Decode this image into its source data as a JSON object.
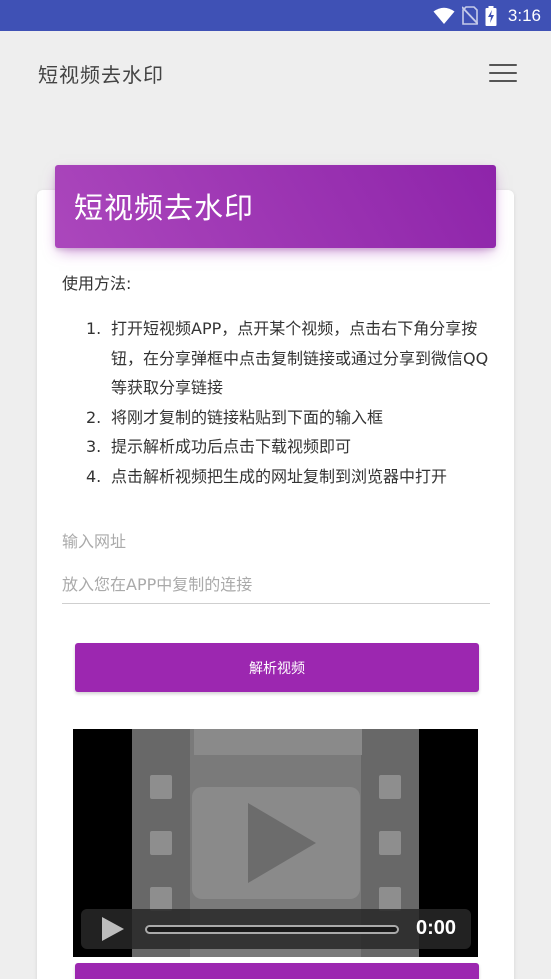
{
  "status_bar": {
    "time": "3:16",
    "icons": [
      "wifi-icon",
      "no-sim-icon",
      "battery-charging-icon"
    ],
    "background": "#3f51b5"
  },
  "app_bar": {
    "title": "短视频去水印",
    "menu_icon": "hamburger-menu-icon"
  },
  "card": {
    "header_title": "短视频去水印",
    "accent": "#9c27b0",
    "usage_label": "使用方法:",
    "steps": [
      {
        "num": "1.",
        "text": "打开短视频APP，点开某个视频，点击右下角分享按钮，在分享弹框中点击复制链接或通过分享到微信QQ等获取分享链接"
      },
      {
        "num": "2.",
        "text": "将刚才复制的链接粘贴到下面的输入框"
      },
      {
        "num": "3.",
        "text": "提示解析成功后点击下载视频即可"
      },
      {
        "num": "4.",
        "text": "点击解析视频把生成的网址复制到浏览器中打开"
      }
    ],
    "input_label": "输入网址",
    "input_placeholder": "放入您在APP中复制的连接",
    "input_value": "",
    "parse_button": "解析视频"
  },
  "video": {
    "time": "0:00",
    "play_icon": "play-icon"
  }
}
